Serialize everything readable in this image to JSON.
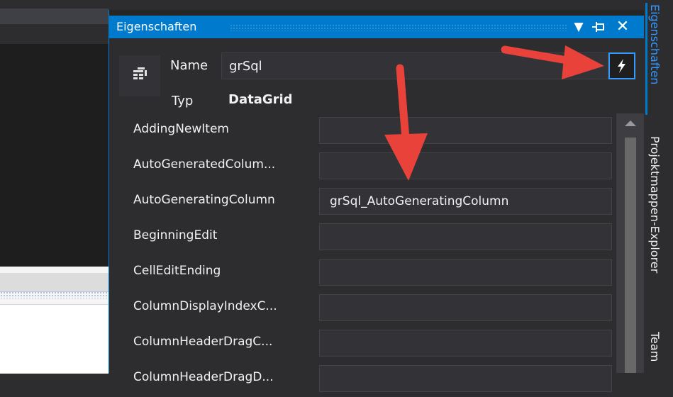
{
  "props_window": {
    "title": "Eigenschaften",
    "dropdown_icon": "▼",
    "pin_icon": "⊣",
    "close_icon": "✕"
  },
  "header": {
    "name_label": "Name",
    "name_value": "grSql",
    "type_label": "Typ",
    "type_value": "DataGrid",
    "events_icon": "⚡"
  },
  "events": [
    {
      "name": "AddingNewItem",
      "handler": ""
    },
    {
      "name": "AutoGeneratedColum...",
      "handler": ""
    },
    {
      "name": "AutoGeneratingColumn",
      "handler": "grSql_AutoGeneratingColumn"
    },
    {
      "name": "BeginningEdit",
      "handler": ""
    },
    {
      "name": "CellEditEnding",
      "handler": ""
    },
    {
      "name": "ColumnDisplayIndexC...",
      "handler": ""
    },
    {
      "name": "ColumnHeaderDragC...",
      "handler": ""
    },
    {
      "name": "ColumnHeaderDragD...",
      "handler": ""
    }
  ],
  "side_tabs": {
    "properties": "Eigenschaften",
    "solution_explorer": "Projektmappen-Explorer",
    "team": "Team"
  },
  "colors": {
    "accent": "#007acc",
    "annotation_arrow": "#e8423a"
  }
}
